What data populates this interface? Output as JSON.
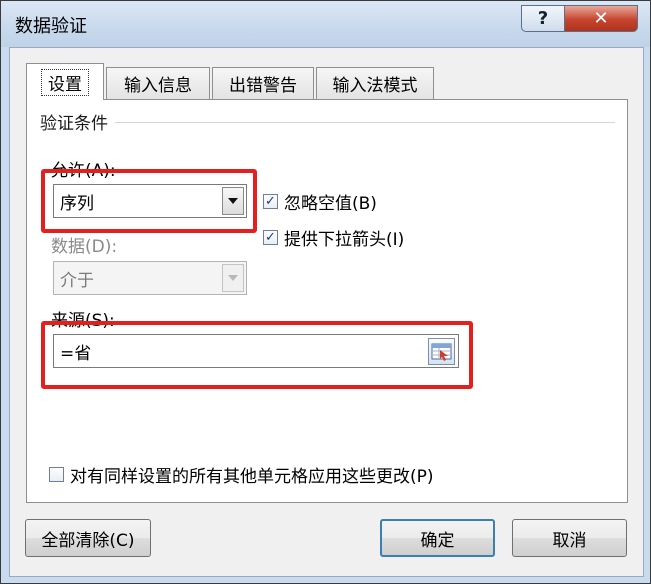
{
  "window": {
    "title": "数据验证",
    "help_label": "?",
    "close_label": "✕"
  },
  "tabs": [
    {
      "label": "设置",
      "active": true
    },
    {
      "label": "输入信息",
      "active": false
    },
    {
      "label": "出错警告",
      "active": false
    },
    {
      "label": "输入法模式",
      "active": false
    }
  ],
  "criteria": {
    "group_title": "验证条件",
    "allow_label": "允许(A):",
    "allow_value": "序列",
    "data_label": "数据(D):",
    "data_value": "介于",
    "ignore_blank": {
      "label": "忽略空值(B)",
      "checked": true
    },
    "in_cell_dropdown": {
      "label": "提供下拉箭头(I)",
      "checked": true
    },
    "source_label": "来源(S):",
    "source_value": "=省"
  },
  "apply_all": {
    "label": "对有同样设置的所有其他单元格应用这些更改(P)",
    "checked": false
  },
  "buttons": {
    "clear_all": "全部清除(C)",
    "ok": "确定",
    "cancel": "取消"
  },
  "colors": {
    "highlight": "#e4201e",
    "title_bar": "#c8d9ec",
    "close_button": "#c6452e"
  },
  "icons": {
    "range_selector": "range-select-icon",
    "dropdown": "chevron-down-icon",
    "check": "checkmark-icon"
  }
}
